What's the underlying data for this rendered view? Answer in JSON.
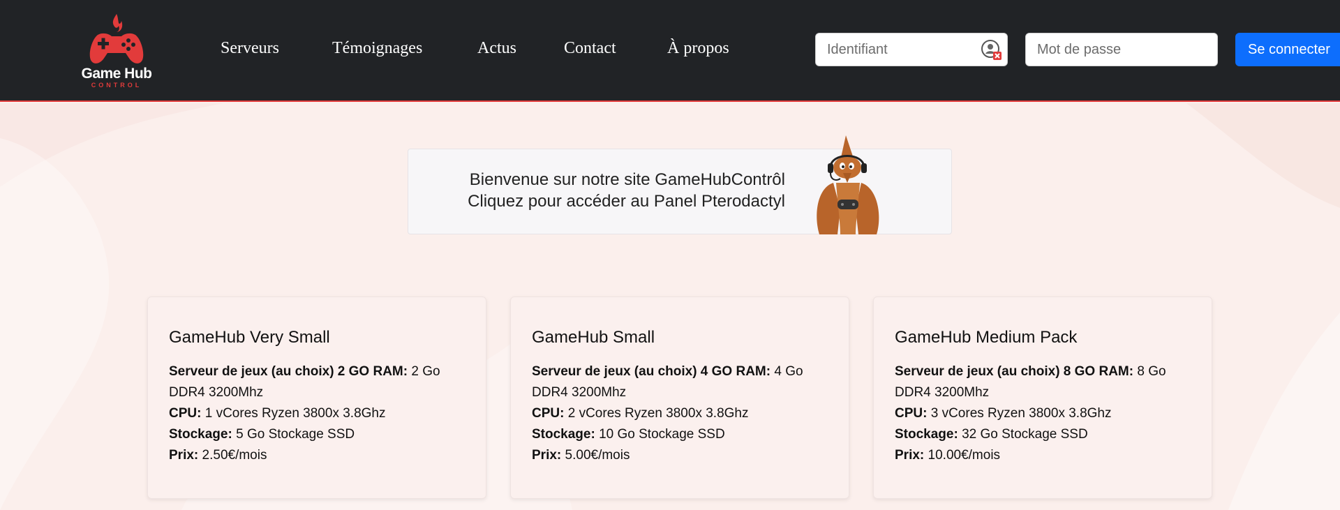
{
  "brand": {
    "name": "Game Hub",
    "subtitle": "CONTROL",
    "logo_icon": "gamepad-flame-icon",
    "accent_color": "#e23b3b"
  },
  "nav": {
    "items": [
      {
        "label": "Serveurs"
      },
      {
        "label": "Témoignages"
      },
      {
        "label": "Actus"
      },
      {
        "label": "Contact"
      },
      {
        "label": "À propos"
      }
    ]
  },
  "login": {
    "username_placeholder": "Identifiant",
    "password_placeholder": "Mot de passe",
    "button_label": "Se connecter",
    "button_color": "#0d6efd",
    "password_manager_icon": "password-manager-icon"
  },
  "banner": {
    "line1": "Bienvenue sur notre site GameHubContrôl",
    "line2": "Cliquez pour accéder au Panel Pterodactyl",
    "mascot_icon": "pterodactyl-mascot-icon"
  },
  "cards": [
    {
      "title": "GameHub Very Small",
      "server_label": "Serveur de jeux (au choix) 2 GO RAM:",
      "server_value": "2 Go",
      "ram_type": "DDR4 3200Mhz",
      "cpu_label": "CPU:",
      "cpu_value": "1 vCores Ryzen 3800x 3.8Ghz",
      "storage_label": "Stockage:",
      "storage_value": "5 Go Stockage SSD",
      "price_label": "Prix:",
      "price_value": "2.50€/mois"
    },
    {
      "title": "GameHub Small",
      "server_label": "Serveur de jeux (au choix) 4 GO RAM:",
      "server_value": "4 Go",
      "ram_type": "DDR4 3200Mhz",
      "cpu_label": "CPU:",
      "cpu_value": "2 vCores Ryzen 3800x 3.8Ghz",
      "storage_label": "Stockage:",
      "storage_value": "10 Go Stockage SSD",
      "price_label": "Prix:",
      "price_value": "5.00€/mois"
    },
    {
      "title": "GameHub Medium Pack",
      "server_label": "Serveur de jeux (au choix) 8 GO RAM:",
      "server_value": "8 Go",
      "ram_type": "DDR4 3200Mhz",
      "cpu_label": "CPU:",
      "cpu_value": "3 vCores Ryzen 3800x 3.8Ghz",
      "storage_label": "Stockage:",
      "storage_value": "32 Go Stockage SSD",
      "price_label": "Prix:",
      "price_value": "10.00€/mois"
    }
  ]
}
